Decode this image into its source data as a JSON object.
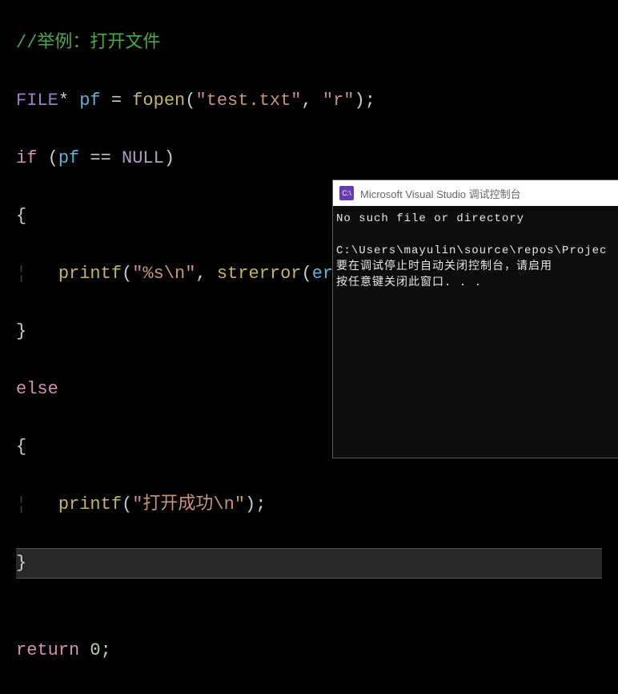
{
  "code": {
    "line1_comment": "//举例：打开文件",
    "line2": {
      "type": "FILE",
      "star": "*",
      "var": "pf",
      "eq": "=",
      "fn": "fopen",
      "lp": "(",
      "arg1": "\"test.txt\"",
      "comma": ",",
      "arg2": "\"r\"",
      "rp": ")",
      "semi": ";"
    },
    "line3": {
      "kw": "if",
      "lp": "(",
      "var": "pf",
      "eqeq": "==",
      "macro": "NULL",
      "rp": ")"
    },
    "line4_brace": "{",
    "line5": {
      "fn": "printf",
      "lp": "(",
      "arg1": "\"%s\\n\"",
      "comma": ",",
      "fn2": "strerror",
      "lp2": "(",
      "arg2": "errno",
      "rp2": ")",
      "rp": ")",
      "semi": ";"
    },
    "line6_brace": "}",
    "line7_else": "else",
    "line8_brace": "{",
    "line9": {
      "fn": "printf",
      "lp": "(",
      "arg1": "\"打开成功\\n\"",
      "rp": ")",
      "semi": ";"
    },
    "line10_brace": "}",
    "line12": {
      "kw": "return",
      "num": "0",
      "semi": ";"
    }
  },
  "console": {
    "title": "Microsoft Visual Studio 调试控制台",
    "icon_text": "C:\\",
    "out1": "No such file or directory",
    "out2": "C:\\Users\\mayulin\\source\\repos\\Projec",
    "out3": "要在调试停止时自动关闭控制台，请启用",
    "out4": "按任意键关闭此窗口. . ."
  }
}
